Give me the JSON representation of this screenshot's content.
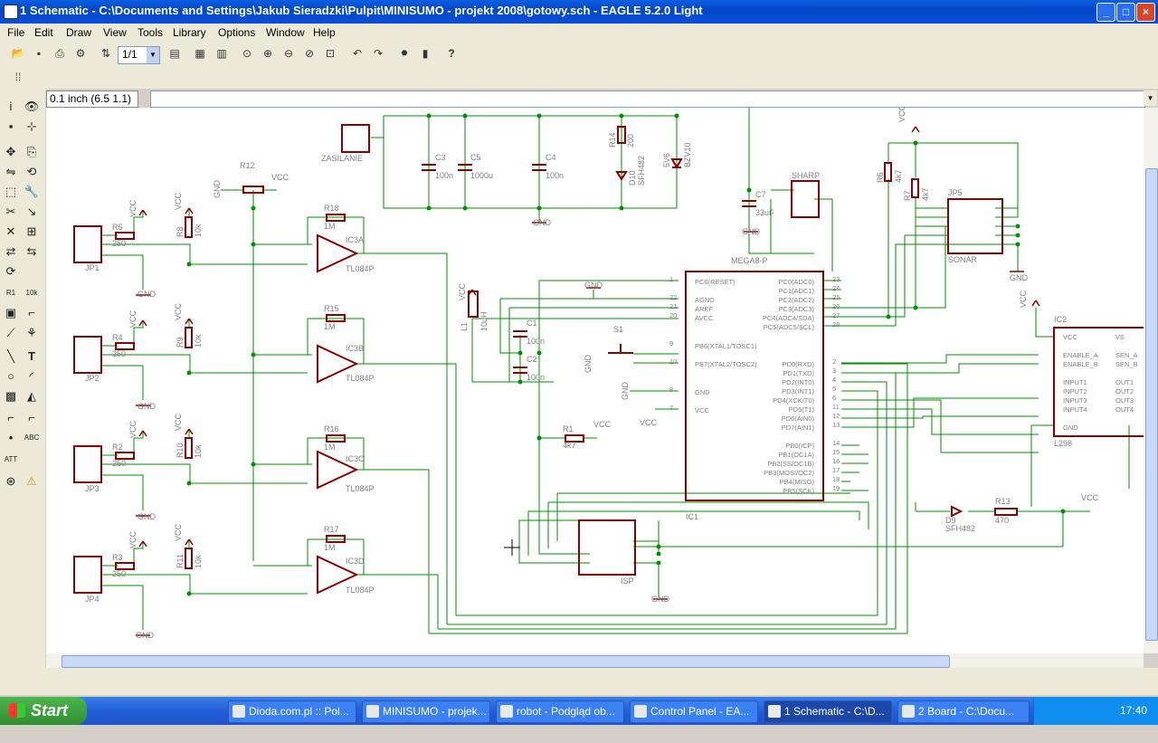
{
  "window": {
    "title": "1 Schematic - C:\\Documents and Settings\\Jakub Sieradzki\\Pulpit\\MINISUMO - projekt 2008\\gotowy.sch - EAGLE 5.2.0 Light"
  },
  "menu": [
    "File",
    "Edit",
    "Draw",
    "View",
    "Tools",
    "Library",
    "Options",
    "Window",
    "Help"
  ],
  "toolbar": {
    "zoom_value": "1/1"
  },
  "coord_display": "0.1 inch (6.5 1.1)",
  "command_line": "",
  "schematic": {
    "labels": {
      "zasilanie": "ZASILANIE",
      "c3": "C3",
      "c3v": "100n",
      "c5": "C5",
      "c5v": "1000u",
      "c4": "C4",
      "c4v": "100n",
      "r14": "R14",
      "r14v": "200",
      "d10": "D10",
      "d10v": "SFH482",
      "zd": "5V6",
      "zdv": "BZV10",
      "gnd": "GND",
      "vcc": "VCC",
      "r12": "R12",
      "sharp": "SHARP",
      "c7": "C7",
      "c7v": "33uF",
      "r6": "R6",
      "r6v": "4k7",
      "r7": "R7",
      "r7v": "4k7",
      "jp5": "JP5",
      "sonar": "SONAR",
      "mega": "MEGA8-P",
      "ic1": "IC1",
      "ic2": "IC2",
      "l298": "L298",
      "isp": "ISP",
      "l1": "L1",
      "l1v": "10uH",
      "c1": "C1",
      "c1v": "100n",
      "c2": "C2",
      "c2v": "100n",
      "s1": "S1",
      "r1": "R1",
      "r1v": "4k7",
      "d9": "D9",
      "d9v": "SFH482",
      "r13": "R13",
      "r13v": "470"
    },
    "channels": [
      {
        "jp": "JP1",
        "r": "R5",
        "rv": "250",
        "rp": "R8",
        "rpv": "10k",
        "rf": "R18",
        "rfv": "1M",
        "ic": "IC3A",
        "icv": "TL084P"
      },
      {
        "jp": "JP2",
        "r": "R4",
        "rv": "250",
        "rp": "R9",
        "rpv": "10k",
        "rf": "R15",
        "rfv": "1M",
        "ic": "IC3B",
        "icv": "TL084P"
      },
      {
        "jp": "JP3",
        "r": "R2",
        "rv": "250",
        "rp": "R10",
        "rpv": "10k",
        "rf": "R16",
        "rfv": "1M",
        "ic": "IC3C",
        "icv": "TL084P"
      },
      {
        "jp": "JP4",
        "r": "R3",
        "rv": "250",
        "rp": "R11",
        "rpv": "10k",
        "rf": "R17",
        "rfv": "1M",
        "ic": "IC3D",
        "icv": "TL084P"
      }
    ],
    "mega_left_pins": [
      {
        "num": "1",
        "name": "PC6(RESET)"
      },
      {
        "num": "22",
        "name": "AGND"
      },
      {
        "num": "21",
        "name": "AREF"
      },
      {
        "num": "20",
        "name": "AVCC"
      },
      {
        "num": "9",
        "name": "PB6(XTAL1/TOSC1)"
      },
      {
        "num": "10",
        "name": "PB7(XTAL2/TOSC2)"
      },
      {
        "num": "8",
        "name": "GND"
      },
      {
        "num": "7",
        "name": "VCC"
      }
    ],
    "mega_right_pins": [
      {
        "num": "23",
        "name": "PC0(ADC0)"
      },
      {
        "num": "24",
        "name": "PC1(ADC1)"
      },
      {
        "num": "25",
        "name": "PC2(ADC2)"
      },
      {
        "num": "26",
        "name": "PC3(ADC3)"
      },
      {
        "num": "27",
        "name": "PC4(ADC4/SDA)"
      },
      {
        "num": "28",
        "name": "PC5(ADC5/SCL)"
      },
      {
        "num": "2",
        "name": "PD0(RXD)"
      },
      {
        "num": "3",
        "name": "PD1(TXD)"
      },
      {
        "num": "4",
        "name": "PD2(INT0)"
      },
      {
        "num": "5",
        "name": "PD3(INT1)"
      },
      {
        "num": "6",
        "name": "PD4(XCK/T0)"
      },
      {
        "num": "11",
        "name": "PD5(T1)"
      },
      {
        "num": "12",
        "name": "PD6(AIN0)"
      },
      {
        "num": "13",
        "name": "PD7(AIN1)"
      },
      {
        "num": "14",
        "name": "PB0(ICP)"
      },
      {
        "num": "15",
        "name": "PB1(OC1A)"
      },
      {
        "num": "16",
        "name": "PB2(SS/OC1B)"
      },
      {
        "num": "17",
        "name": "PB3(MOSI/OC2)"
      },
      {
        "num": "18",
        "name": "PB4(MISO)"
      },
      {
        "num": "19",
        "name": "PB5(SCK)"
      }
    ],
    "l298_left": [
      "VCC",
      "ENABLE_A",
      "ENABLE_B",
      "INPUT1",
      "INPUT2",
      "INPUT3",
      "INPUT4",
      "GND"
    ],
    "l298_right": [
      "VS",
      "SEN_A",
      "SEN_B",
      "OUT1",
      "OUT2",
      "OUT3",
      "OUT4"
    ]
  },
  "taskbar": {
    "start": "Start",
    "tasks": [
      "Dioda.com.pl :: Pol...",
      "MINISUMO - projek...",
      "robot - Podgląd ob...",
      "Control Panel - EA...",
      "1 Schematic - C:\\D...",
      "2 Board - C:\\Docu..."
    ],
    "clock": "17:40"
  },
  "colors": {
    "wire": "#009000",
    "part": "#8b0000",
    "text": "#808080",
    "canvas": "#ffffff"
  }
}
